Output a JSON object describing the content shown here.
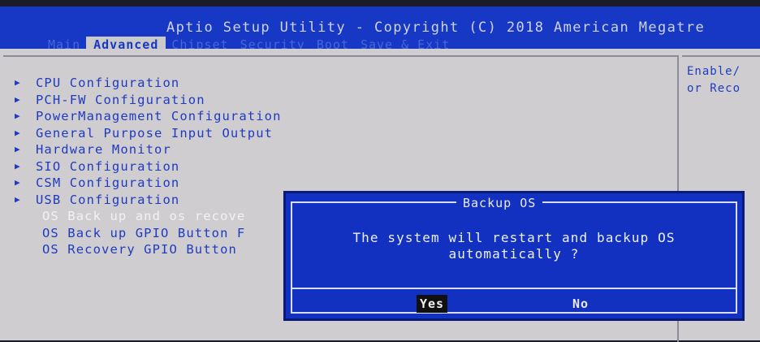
{
  "header": {
    "title": "Aptio Setup Utility - Copyright (C) 2018 American Megatre",
    "tabs": [
      {
        "label": "Main",
        "active": false
      },
      {
        "label": "Advanced",
        "active": true
      },
      {
        "label": "Chipset",
        "active": false
      },
      {
        "label": "Security",
        "active": false
      },
      {
        "label": "Boot",
        "active": false
      },
      {
        "label": "Save & Exit",
        "active": false
      }
    ]
  },
  "menu": {
    "items": [
      {
        "label": "CPU Configuration",
        "submenu": true
      },
      {
        "label": "PCH-FW Configuration",
        "submenu": true
      },
      {
        "label": "PowerManagement Configuration",
        "submenu": true
      },
      {
        "label": "General Purpose Input Output",
        "submenu": true
      },
      {
        "label": "Hardware Monitor",
        "submenu": true
      },
      {
        "label": "SIO Configuration",
        "submenu": true
      },
      {
        "label": "CSM Configuration",
        "submenu": true
      },
      {
        "label": "USB Configuration",
        "submenu": true
      },
      {
        "label": "OS Back up and os recove",
        "submenu": false
      },
      {
        "label": "OS Back up GPIO Button F",
        "submenu": false
      },
      {
        "label": "OS Recovery GPIO Button",
        "submenu": false
      }
    ]
  },
  "help": {
    "lines": [
      "Enable/",
      "or Reco"
    ]
  },
  "dialog": {
    "title": "Backup OS",
    "message_line1": "The system will restart and backup OS",
    "message_line2": "automatically ?",
    "yes_label": "Yes",
    "no_label": "No",
    "selected": "Yes"
  },
  "colors": {
    "header_bg": "#1638c4",
    "panel_bg": "#cfcdd0",
    "menu_text": "#1f3bbf",
    "dialog_bg": "#1231c0"
  },
  "icons": {
    "submenu_arrow": "right-triangle"
  }
}
